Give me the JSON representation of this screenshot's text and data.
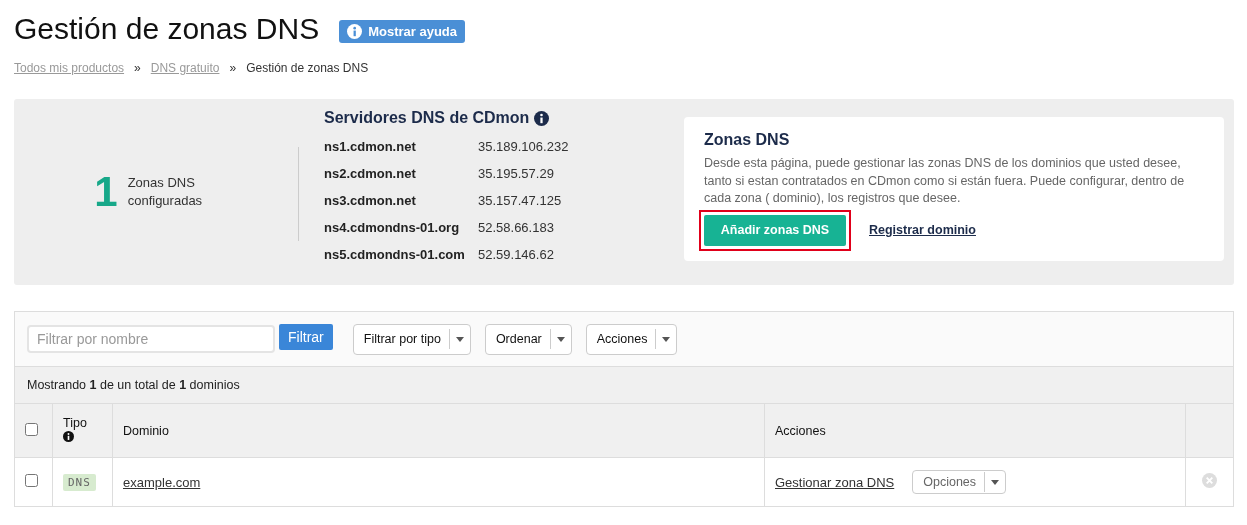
{
  "page": {
    "title": "Gestión de zonas DNS",
    "help_button": "Mostrar ayuda"
  },
  "breadcrumb": [
    {
      "label": "Todos mis productos",
      "link": true
    },
    {
      "label": "DNS gratuito",
      "link": true
    },
    {
      "label": "Gestión de zonas DNS",
      "link": false
    }
  ],
  "breadcrumb_separator": "»",
  "summary": {
    "count": "1",
    "count_label": "Zonas DNS configuradas",
    "servers_title": "Servidores DNS de CDmon",
    "servers": [
      {
        "name": "ns1.cdmon.net",
        "ip": "35.189.106.232"
      },
      {
        "name": "ns2.cdmon.net",
        "ip": "35.195.57.29"
      },
      {
        "name": "ns3.cdmon.net",
        "ip": "35.157.47.125"
      },
      {
        "name": "ns4.cdmondns-01.org",
        "ip": "52.58.66.183"
      },
      {
        "name": "ns5.cdmondns-01.com",
        "ip": "52.59.146.62"
      }
    ]
  },
  "info_card": {
    "title": "Zonas DNS",
    "text": "Desde esta página, puede gestionar las zonas DNS de los dominios que usted desee, tanto si estan contratados en CDmon como si están fuera. Puede configurar, dentro de cada zona ( dominio), los registros que desee.",
    "add_button": "Añadir zonas DNS",
    "add_button_highlighted": true,
    "register_link": "Registrar dominio"
  },
  "toolbar": {
    "search": {
      "placeholder": "Filtrar por nombre"
    },
    "filter_button": "Filtrar",
    "dropdowns": [
      "Filtrar por tipo",
      "Ordenar",
      "Acciones"
    ]
  },
  "results_text": "Mostrando **1** de un total de **1** dominios",
  "table": {
    "select_all_checked": false,
    "columns": [
      "Tipo",
      "Dominio",
      "Acciones"
    ],
    "rows": [
      {
        "checked": false,
        "type": "DNS",
        "domain": "example.com",
        "manage_link": "Gestionar zona DNS",
        "options": "Opciones"
      }
    ]
  }
}
